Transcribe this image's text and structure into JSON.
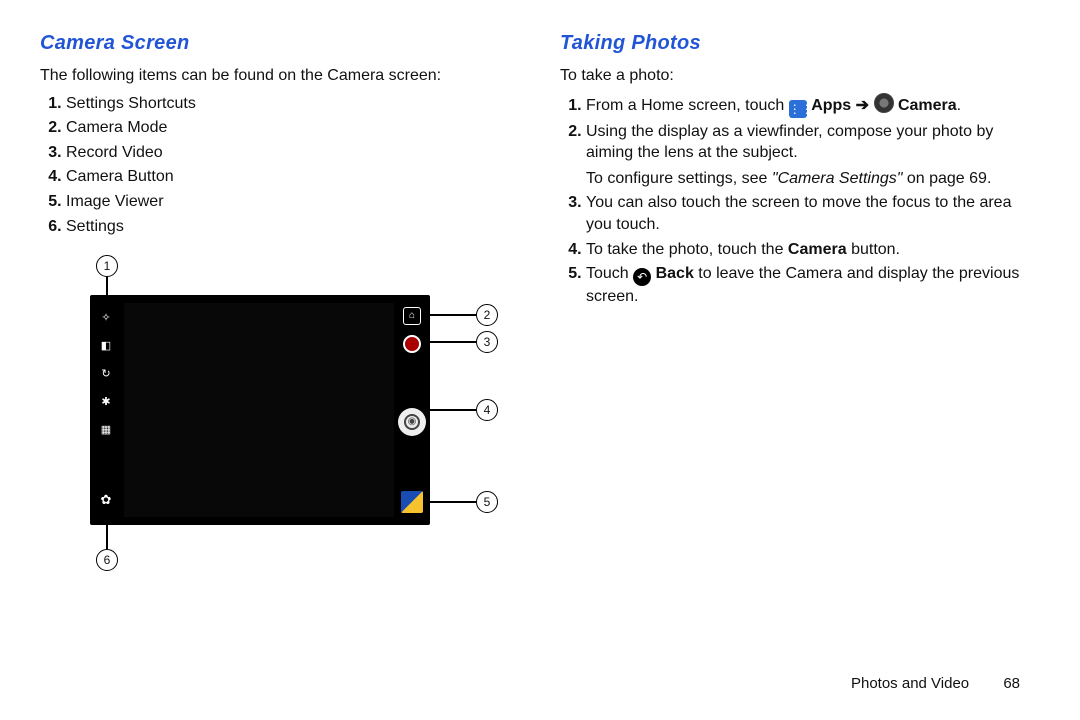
{
  "left": {
    "heading": "Camera Screen",
    "intro": "The following items can be found on the Camera screen:",
    "items": [
      "Settings Shortcuts",
      "Camera Mode",
      "Record Video",
      "Camera Button",
      "Image Viewer",
      "Settings"
    ],
    "callouts": [
      "1",
      "2",
      "3",
      "4",
      "5",
      "6"
    ]
  },
  "right": {
    "heading": "Taking Photos",
    "intro": "To take a photo:",
    "step1_a": "From a Home screen, touch ",
    "step1_apps": "Apps",
    "step1_arrow": "➔",
    "step1_camera": "Camera",
    "step1_end": ".",
    "step2_a": "Using the display as a viewfinder, compose your photo by aiming the lens at the subject.",
    "step2_b_pre": "To configure settings, see ",
    "step2_b_link": "\"Camera Settings\"",
    "step2_b_post": " on page 69.",
    "step3": "You can also touch the screen to move the focus to the area you touch.",
    "step4_pre": "To take the photo, touch the ",
    "step4_bold": "Camera",
    "step4_post": " button.",
    "step5_pre": "Touch ",
    "step5_bold": "Back",
    "step5_post": " to leave the Camera and display the previous screen."
  },
  "footer": {
    "section": "Photos and Video",
    "page": "68"
  }
}
